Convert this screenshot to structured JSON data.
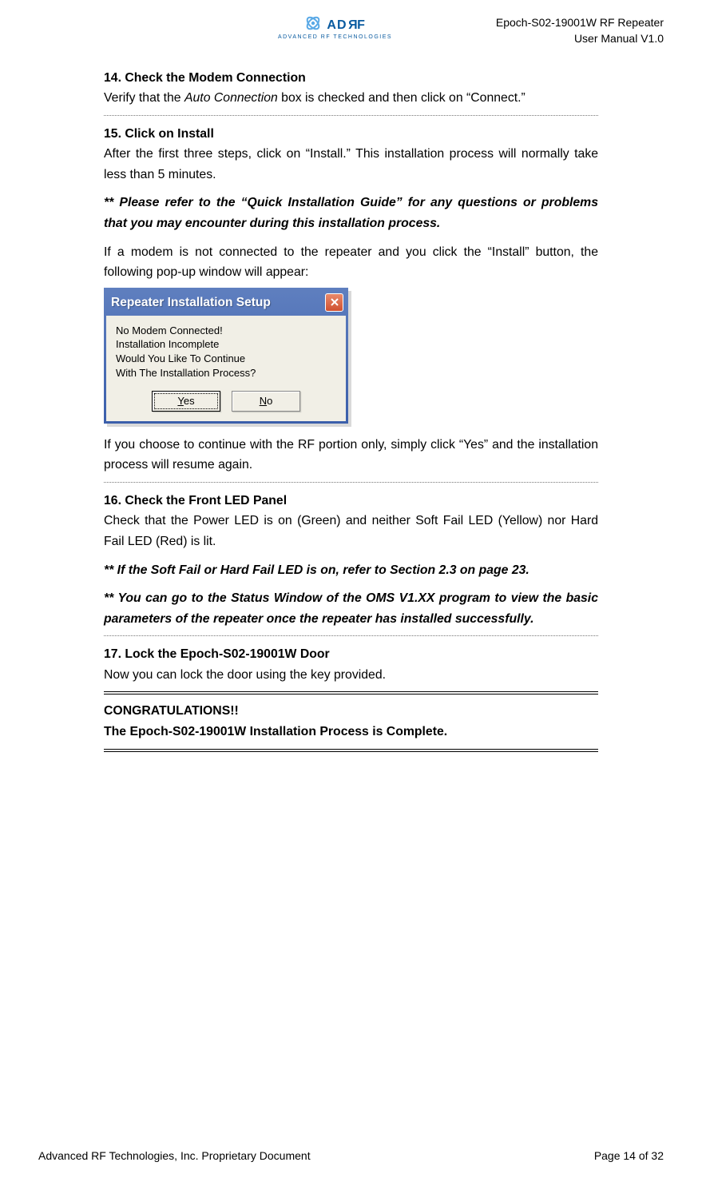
{
  "header": {
    "logo_main": "ADRF",
    "logo_sub": "ADVANCED RF TECHNOLOGIES",
    "right1": "Epoch-S02-19001W RF Repeater",
    "right2": "User Manual V1.0"
  },
  "step14": {
    "head": "14. Check the Modem Connection",
    "body_a": "Verify that the ",
    "body_ital": "Auto Connection",
    "body_b": " box is checked and then click on “Connect.”"
  },
  "step15": {
    "head": "15.  Click on Install",
    "body1": "After the first three steps, click on “Install.”  This installation process will normally take less than 5 minutes.",
    "note": "** Please refer to the “Quick Installation Guide” for any questions or problems that you may encounter during this installation process.",
    "body2": "If a modem is not connected to the repeater and you click the “Install” button, the following pop-up window will appear:",
    "body3": "If you choose to continue with the RF portion only, simply click “Yes” and the installation process will resume again."
  },
  "dialog": {
    "title": "Repeater Installation Setup",
    "line1": "No Modem Connected!",
    "line2": "Installation Incomplete",
    "line3": "Would You Like To Continue",
    "line4": "With The Installation Process?",
    "yes_u": "Y",
    "yes_rest": "es",
    "no_u": "N",
    "no_rest": "o"
  },
  "step16": {
    "head": "16. Check the Front LED Panel",
    "body": "Check that the Power LED is on (Green) and neither Soft Fail LED (Yellow) nor Hard Fail LED (Red) is lit.",
    "note1": "** If the Soft Fail or Hard Fail LED is on, refer to Section 2.3 on page 23.",
    "note2": "** You can go to the Status Window of the OMS V1.XX program to view the basic parameters of the repeater once the repeater has installed successfully."
  },
  "step17": {
    "head": "17. Lock the Epoch-S02-19001W Door",
    "body": "Now you can lock the door using the key provided."
  },
  "congrats": {
    "line1": "CONGRATULATIONS!!",
    "line2": "The Epoch-S02-19001W Installation Process is Complete."
  },
  "footer": {
    "left": "Advanced RF Technologies, Inc. Proprietary Document",
    "right": "Page 14 of 32"
  }
}
